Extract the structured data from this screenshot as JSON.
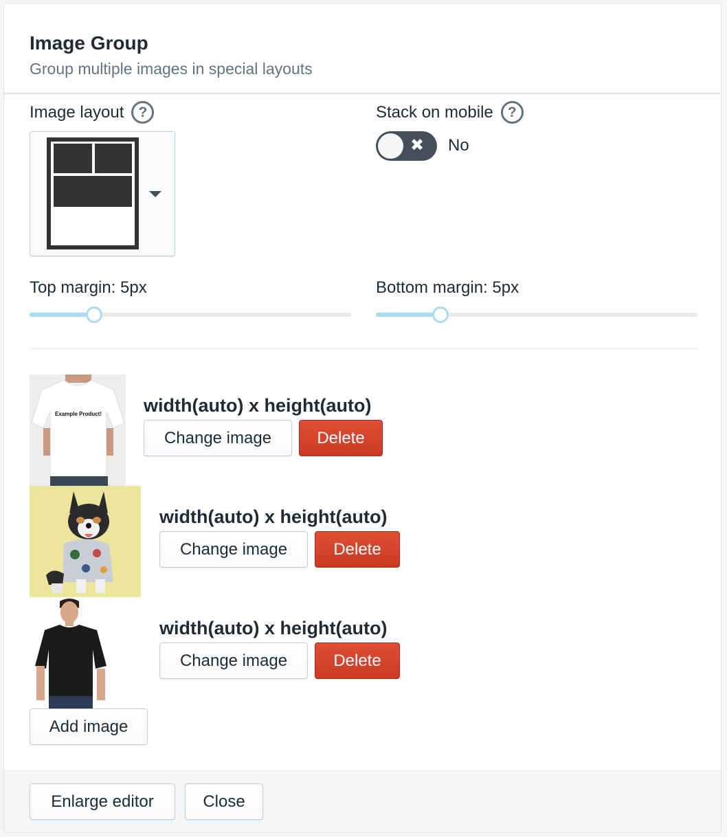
{
  "header": {
    "title": "Image Group",
    "subtitle": "Group multiple images in special layouts"
  },
  "image_layout": {
    "label": "Image layout",
    "help_icon": "question-circle-icon",
    "selected_layout": "two-top-one-wide-bottom",
    "dropdown_icon": "caret-down-icon"
  },
  "stack_on_mobile": {
    "label": "Stack on mobile",
    "help_icon": "question-circle-icon",
    "enabled": false,
    "toggle_glyph": "✖",
    "state_label": "No"
  },
  "top_margin": {
    "label": "Top margin: 5px",
    "value": 5,
    "fraction": 0.2
  },
  "bottom_margin": {
    "label": "Bottom margin: 5px",
    "value": 5,
    "fraction": 0.2
  },
  "images": [
    {
      "thumbnail": "white-tshirt-photo",
      "thumbnail_text": "Example Product!",
      "dimensions": "width(auto) x height(auto)",
      "change_label": "Change image",
      "delete_label": "Delete"
    },
    {
      "thumbnail": "corgi-photo",
      "dimensions": "width(auto) x height(auto)",
      "change_label": "Change image",
      "delete_label": "Delete"
    },
    {
      "thumbnail": "black-tshirt-photo",
      "dimensions": "width(auto) x height(auto)",
      "change_label": "Change image",
      "delete_label": "Delete"
    }
  ],
  "add_image_label": "Add image",
  "footer": {
    "enlarge_label": "Enlarge editor",
    "close_label": "Close"
  },
  "colors": {
    "danger": "#d03f28",
    "slider_accent": "#a8dbee",
    "toggle_off": "#454f5b"
  }
}
